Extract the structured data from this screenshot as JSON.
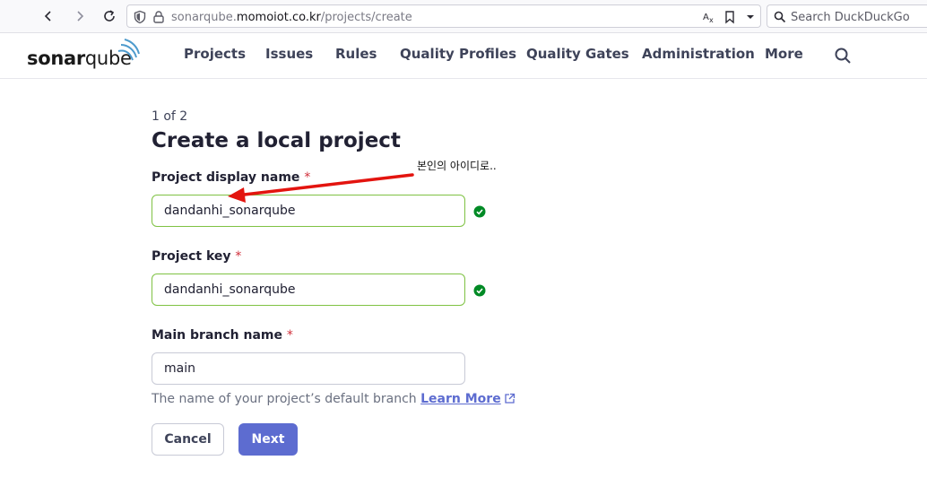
{
  "browser": {
    "url_prefix": "sonarqube.",
    "url_host": "momoiot.co.kr",
    "url_path": "/projects/create",
    "search_placeholder": "Search DuckDuckGo"
  },
  "header": {
    "logo_bold": "sonar",
    "logo_light": "qube",
    "nav": [
      {
        "label": "Projects"
      },
      {
        "label": "Issues"
      },
      {
        "label": "Rules"
      },
      {
        "label": "Quality Profiles"
      },
      {
        "label": "Quality Gates"
      },
      {
        "label": "Administration"
      },
      {
        "label": "More"
      }
    ]
  },
  "form": {
    "step": "1 of 2",
    "title": "Create a local project",
    "display_name": {
      "label": "Project display name",
      "required": "*",
      "value": "dandanhi_sonarqube"
    },
    "project_key": {
      "label": "Project key",
      "required": "*",
      "value": "dandanhi_sonarqube"
    },
    "branch": {
      "label": "Main branch name",
      "required": "*",
      "value": "main"
    },
    "hint": "The name of your project’s default branch",
    "learn_more": "Learn More",
    "cancel": "Cancel",
    "next": "Next"
  },
  "annotation": {
    "text": "본인의 아이디로.."
  },
  "colors": {
    "accent": "#5d6cd0",
    "valid_border": "#7fc243",
    "valid_check": "#008a25",
    "required": "#d02f3a",
    "arrow": "#e3140f"
  }
}
